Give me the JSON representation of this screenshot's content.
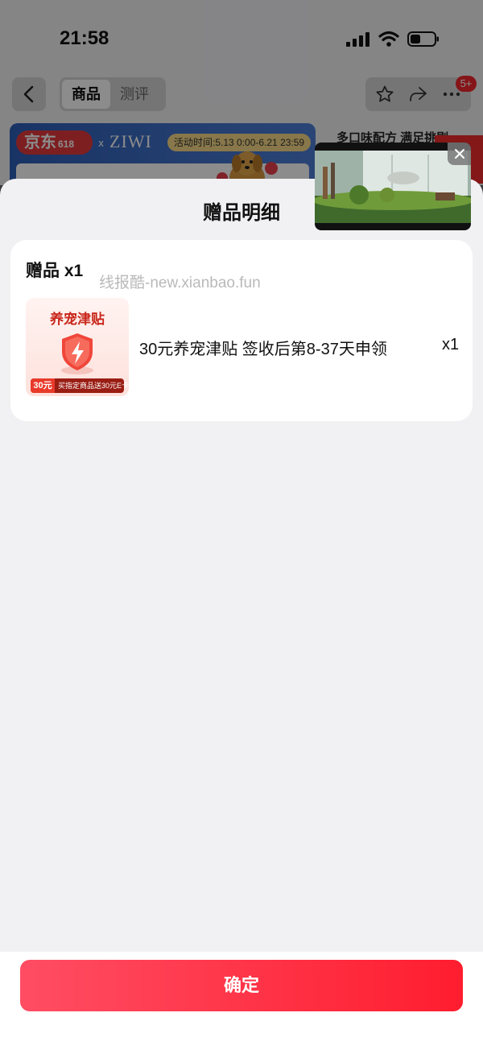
{
  "status_bar": {
    "time": "21:58"
  },
  "nav": {
    "tabs": [
      "商品",
      "测评"
    ],
    "badge": "5+"
  },
  "banner": {
    "logo_text": "京东",
    "logo_618": "618",
    "x": "x",
    "brand": "ZIWI",
    "activity_time": "活动时间:5.13 0:00-6.21 23:59"
  },
  "feature_text": "多口味配方 满足挑剔",
  "sheet": {
    "title": "赠品明细",
    "gift_heading": "赠品 x1",
    "watermark": "线报酷-new.xianbao.fun",
    "gift": {
      "thumb_title": "养宠津贴",
      "thumb_amount": "30元",
      "thumb_strip_text": "买指定商品送30元E卡",
      "name": "30元养宠津贴 签收后第8-37天申领",
      "qty": "x1"
    }
  },
  "footer": {
    "confirm_label": "确定"
  },
  "colors": {
    "accent": "#ff1d2f",
    "badge": "#f2272d"
  }
}
